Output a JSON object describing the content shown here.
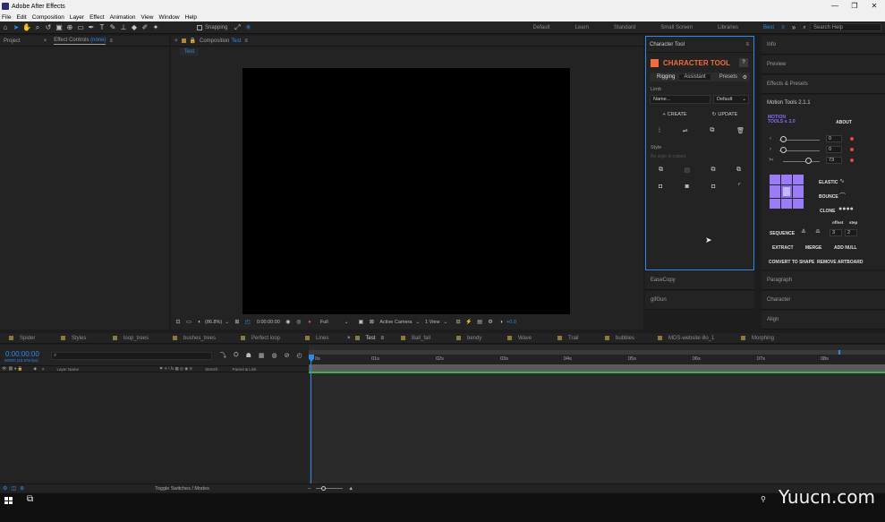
{
  "window": {
    "title": "Adobe After Effects",
    "min": "—",
    "max": "❐",
    "close": "✕"
  },
  "menu": [
    "File",
    "Edit",
    "Composition",
    "Layer",
    "Effect",
    "Animation",
    "View",
    "Window",
    "Help"
  ],
  "toolbar": {
    "snapping_label": "Snapping",
    "workspaces": [
      "Default",
      "Learn",
      "Standard",
      "Small Screen",
      "Libraries",
      "Best"
    ],
    "active_workspace": "Best",
    "search_placeholder": "Search Help"
  },
  "project_panel": {
    "tab_project": "Project",
    "tab_effect_controls": "Effect Controls",
    "effect_controls_target": "(none)"
  },
  "composition_panel": {
    "tab_label": "Composition",
    "comp_name": "Test",
    "sub_tab": "Test",
    "zoom": "(86.8%)",
    "timecode": "0:00:00:00",
    "resolution": "Full",
    "camera": "Active Camera",
    "views": "1 View",
    "exposure": "+0.0"
  },
  "character_tool": {
    "panel_title": "Character Tool",
    "brand": "CHARACTER TOOL",
    "help": "?",
    "tabs": [
      "Rigging",
      "Assistant",
      "Presets"
    ],
    "active_tab": "Rigging",
    "limb_label": "Limb",
    "name_placeholder": "Name...",
    "preset_select": "Default",
    "create_label": "CREATE",
    "update_label": "UPDATE",
    "style_label": "Style",
    "style_empty": "No style is copied"
  },
  "left_lower_panels": [
    "EaseCopy",
    "gifGun"
  ],
  "right_panels": {
    "top": [
      "Info",
      "Preview",
      "Effects & Presets"
    ],
    "motion_tools_title": "Motion Tools 2.1.1",
    "motion_logo_line1": "MOTION",
    "motion_logo_line2": "TOOLS v. 2.0",
    "about": "ABOUT",
    "slider_values": [
      "0",
      "0",
      "73"
    ],
    "elastic": "ELASTIC",
    "bounce": "BOUNCE",
    "clone": "CLONE",
    "offset_label": "offset",
    "step_label": "step",
    "sequence": "SEQUENCE",
    "sequence_offset": "3",
    "sequence_step": "2",
    "extract": "EXTRACT",
    "merge": "MERGE",
    "add_null": "ADD NULL",
    "convert_to_shape": "CONVERT TO SHAPE",
    "remove_artboard": "REMOVE ARTBOARD",
    "bottom": [
      "Paragraph",
      "Character",
      "Align"
    ]
  },
  "timeline": {
    "comp_tabs": [
      "Spider",
      "Styles",
      "loop_trees",
      "bushes_trees",
      "Perfect loop",
      "Lines",
      "Test",
      "Ball_fall",
      "bendy",
      "Wave",
      "Trail",
      "bubbles",
      "MDS-website illo_1",
      "Morphing"
    ],
    "active_tab": "Test",
    "timecode": "0:00:00:00",
    "fps_label": "00000 (23.976 fps)",
    "col_layer_name": "Layer Name",
    "col_stretch": "Stretch",
    "col_parent": "Parent & Link",
    "ruler_ticks": [
      "0s",
      "01s",
      "02s",
      "03s",
      "04s",
      "05s",
      "06s",
      "07s",
      "08s"
    ],
    "toggle_label": "Toggle Switches / Modes"
  },
  "watermark": "Yuucn.com",
  "colors": {
    "accent": "#2d8ceb",
    "brand_orange": "#f26b3a",
    "motion_purple": "#8b6cf6",
    "red_dot": "#e8473a"
  }
}
